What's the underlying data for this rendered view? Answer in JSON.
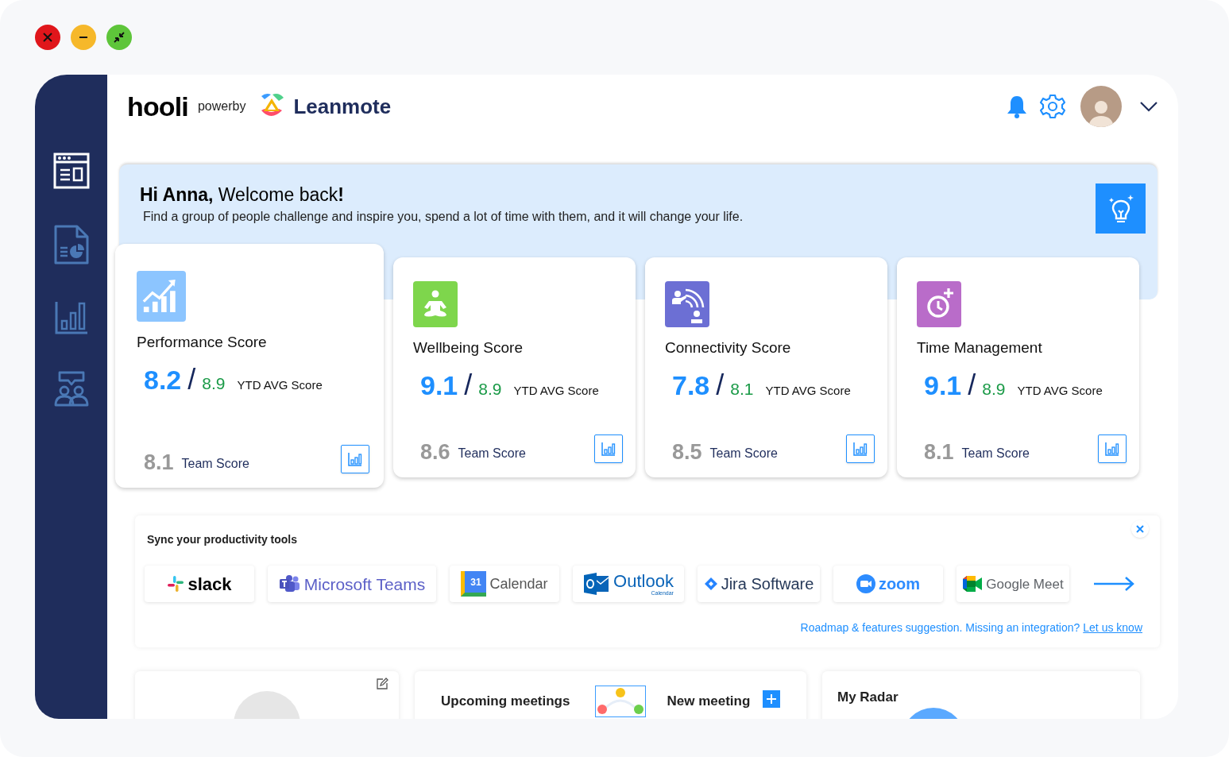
{
  "sidebar": {
    "items": [
      {
        "selected": true
      },
      {
        "selected": false
      },
      {
        "selected": false
      },
      {
        "selected": false
      }
    ]
  },
  "header": {
    "brand": "hooli",
    "powered_by": "powerby",
    "product": "Leanmote"
  },
  "welcome": {
    "greeting": "**Hi Anna,** Welcome back**!**",
    "message": "Find a group of people challenge and inspire you, spend a lot of time with them, and it will change your life."
  },
  "score_cards": [
    {
      "kind": "performance",
      "color": "#8cc5ff",
      "title": "Performance Score",
      "score": "8.2",
      "separator": "/",
      "ytd_score": "8.9",
      "ytd_label": "YTD AVG Score",
      "team_score": "8.1",
      "team_label": "Team Score"
    },
    {
      "kind": "wellbeing",
      "color": "#7ed64c",
      "title": "Wellbeing Score",
      "score": "9.1",
      "separator": "/",
      "ytd_score": "8.9",
      "ytd_label": "YTD AVG Score",
      "team_score": "8.6",
      "team_label": "Team Score"
    },
    {
      "kind": "connectivity",
      "color": "#6c6fd4",
      "title": "Connectivity Score",
      "score": "7.8",
      "separator": "/",
      "ytd_score": "8.1",
      "ytd_label": "YTD AVG Score",
      "team_score": "8.5",
      "team_label": "Team Score"
    },
    {
      "kind": "time",
      "color": "#b96cc9",
      "title": "Time Management",
      "score": "9.1",
      "separator": "/",
      "ytd_score": "8.9",
      "ytd_label": "YTD AVG Score",
      "team_score": "8.1",
      "team_label": "Team Score"
    }
  ],
  "sync_tools": {
    "title": "Sync your productivity tools",
    "tools": [
      {
        "kind": "slack",
        "label": "slack"
      },
      {
        "kind": "teams",
        "label": "Microsoft Teams"
      },
      {
        "kind": "calendar",
        "label": "Calendar",
        "badge": "31"
      },
      {
        "kind": "outlook",
        "label": "Outlook",
        "sublabel": "Calendar"
      },
      {
        "kind": "jira",
        "label": "Jira Software"
      },
      {
        "kind": "zoom",
        "label": "zoom"
      },
      {
        "kind": "meet",
        "label": "Google Meet"
      }
    ],
    "footer_text": "Roadmap & features suggestion. Missing an integration?",
    "footer_link": "Let us know"
  },
  "meetings": {
    "title": "Upcoming meetings",
    "new_meeting": "New meeting"
  },
  "radar": {
    "title": "My Radar"
  }
}
